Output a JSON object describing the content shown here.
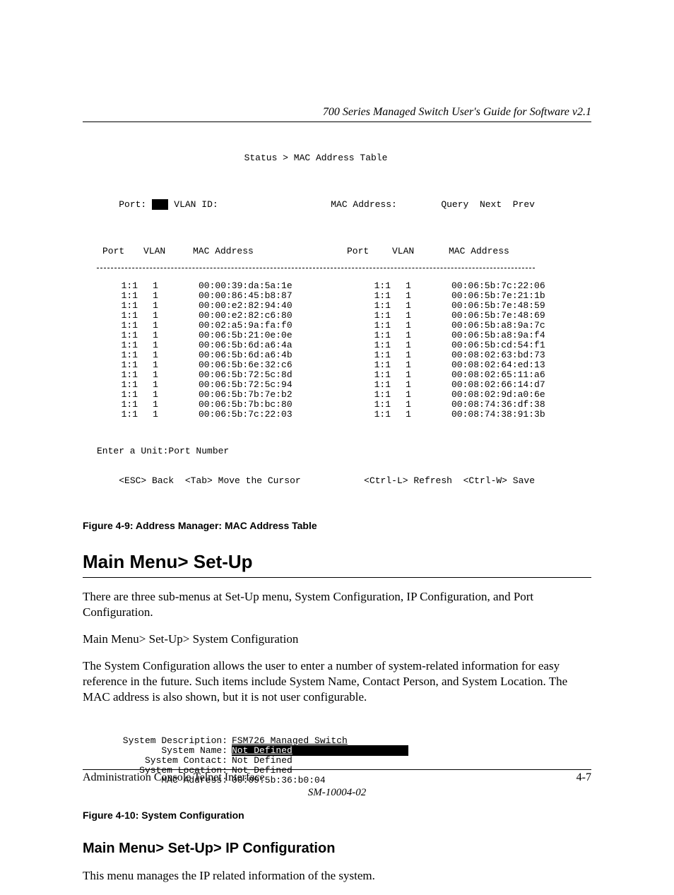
{
  "header": {
    "running_head": "700 Series Managed Switch User's Guide for Software v2.1"
  },
  "fig49": {
    "breadcrumb": "Status > MAC Address Table",
    "filter": {
      "port_label": "Port:",
      "port_value": "   ",
      "vlan_label": "VLAN ID:",
      "mac_label": "MAC Address:"
    },
    "buttons": {
      "query": "Query",
      "next": "Next",
      "prev": "Prev"
    },
    "columns": {
      "port": "Port",
      "vlan": "VLAN",
      "mac": "MAC Address"
    },
    "rows": [
      {
        "pl": "1:1",
        "vl": "1",
        "ml": "00:00:39:da:5a:1e",
        "pr": "1:1",
        "vr": "1",
        "mr": "00:06:5b:7c:22:06"
      },
      {
        "pl": "1:1",
        "vl": "1",
        "ml": "00:00:86:45:b8:87",
        "pr": "1:1",
        "vr": "1",
        "mr": "00:06:5b:7e:21:1b"
      },
      {
        "pl": "1:1",
        "vl": "1",
        "ml": "00:00:e2:82:94:40",
        "pr": "1:1",
        "vr": "1",
        "mr": "00:06:5b:7e:48:59"
      },
      {
        "pl": "1:1",
        "vl": "1",
        "ml": "00:00:e2:82:c6:80",
        "pr": "1:1",
        "vr": "1",
        "mr": "00:06:5b:7e:48:69"
      },
      {
        "pl": "1:1",
        "vl": "1",
        "ml": "00:02:a5:9a:fa:f0",
        "pr": "1:1",
        "vr": "1",
        "mr": "00:06:5b:a8:9a:7c"
      },
      {
        "pl": "1:1",
        "vl": "1",
        "ml": "00:06:5b:21:0e:0e",
        "pr": "1:1",
        "vr": "1",
        "mr": "00:06:5b:a8:9a:f4"
      },
      {
        "pl": "1:1",
        "vl": "1",
        "ml": "00:06:5b:6d:a6:4a",
        "pr": "1:1",
        "vr": "1",
        "mr": "00:06:5b:cd:54:f1"
      },
      {
        "pl": "1:1",
        "vl": "1",
        "ml": "00:06:5b:6d:a6:4b",
        "pr": "1:1",
        "vr": "1",
        "mr": "00:08:02:63:bd:73"
      },
      {
        "pl": "1:1",
        "vl": "1",
        "ml": "00:06:5b:6e:32:c6",
        "pr": "1:1",
        "vr": "1",
        "mr": "00:08:02:64:ed:13"
      },
      {
        "pl": "1:1",
        "vl": "1",
        "ml": "00:06:5b:72:5c:8d",
        "pr": "1:1",
        "vr": "1",
        "mr": "00:08:02:65:11:a6"
      },
      {
        "pl": "1:1",
        "vl": "1",
        "ml": "00:06:5b:72:5c:94",
        "pr": "1:1",
        "vr": "1",
        "mr": "00:08:02:66:14:d7"
      },
      {
        "pl": "1:1",
        "vl": "1",
        "ml": "00:06:5b:7b:7e:b2",
        "pr": "1:1",
        "vr": "1",
        "mr": "00:08:02:9d:a0:6e"
      },
      {
        "pl": "1:1",
        "vl": "1",
        "ml": "00:06:5b:7b:bc:80",
        "pr": "1:1",
        "vr": "1",
        "mr": "00:08:74:36:df:38"
      },
      {
        "pl": "1:1",
        "vl": "1",
        "ml": "00:06:5b:7c:22:03",
        "pr": "1:1",
        "vr": "1",
        "mr": "00:08:74:38:91:3b"
      }
    ],
    "prompt": "Enter a Unit:Port Number",
    "keys": {
      "esc": "<ESC> Back",
      "tab": "<Tab> Move the Cursor",
      "refresh": "<Ctrl-L> Refresh",
      "save": "<Ctrl-W> Save"
    },
    "caption": "Figure 4-9:  Address Manager: MAC Address Table"
  },
  "section1": {
    "heading": "Main Menu> Set-Up",
    "para1": "There are three sub-menus at Set-Up menu, System Configuration, IP Configuration, and Port Configuration.",
    "para2": "Main Menu> Set-Up> System Configuration",
    "para3": "The System Configuration allows the user to enter a number of system-related information for easy reference in the future. Such items include System Name, Contact Person, and System Location.  The MAC address is also shown, but it is not user configurable."
  },
  "fig410": {
    "rows": [
      {
        "label": "System Description:",
        "value": "FSM726 Managed Switch",
        "hl": false,
        "under": true
      },
      {
        "label": "System Name:",
        "value": "Not Defined",
        "hl": true,
        "pad": "                     "
      },
      {
        "label": "System Contact:",
        "value": "Not Defined",
        "hl": false
      },
      {
        "label": "System Location:",
        "value": "Not Defined",
        "hl": false
      },
      {
        "label": "MAC Address:",
        "value": "00:09:5b:36:b0:04",
        "hl": false
      }
    ],
    "caption": "Figure 4-10:  System Configuration"
  },
  "section2": {
    "heading": "Main Menu> Set-Up> IP Configuration",
    "para1": "This menu manages the IP related information of the system."
  },
  "footer": {
    "left": "Administration Console Telnet Interface",
    "right": "4-7",
    "docnum": "SM-10004-02"
  }
}
